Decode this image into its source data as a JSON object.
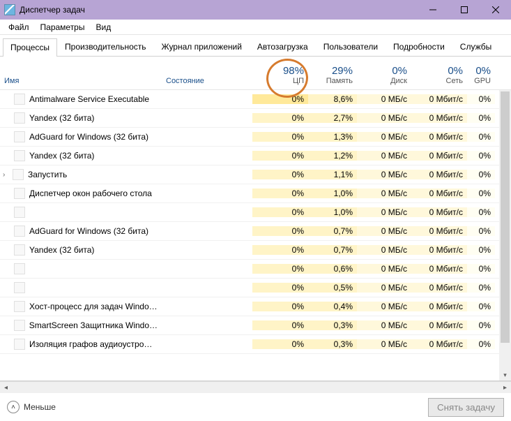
{
  "window": {
    "title": "Диспетчер задач"
  },
  "menu": {
    "file": "Файл",
    "options": "Параметры",
    "view": "Вид"
  },
  "tabs": {
    "processes": "Процессы",
    "performance": "Производительность",
    "app_history": "Журнал приложений",
    "startup": "Автозагрузка",
    "users": "Пользователи",
    "details": "Подробности",
    "services": "Службы"
  },
  "headers": {
    "name": "Имя",
    "state": "Состояние",
    "cpu_pct": "98%",
    "cpu": "ЦП",
    "mem_pct": "29%",
    "mem": "Память",
    "disk_pct": "0%",
    "disk": "Диск",
    "net_pct": "0%",
    "net": "Сеть",
    "gpu_pct": "0%",
    "gpu": "GPU"
  },
  "rows": [
    {
      "name": "Antimalware Service Executable",
      "expand": false,
      "cpu": "0%",
      "cpu_hot": true,
      "mem": "8,6%",
      "disk": "0 МБ/с",
      "net": "0 Мбит/с",
      "gpu": "0%"
    },
    {
      "name": "Yandex (32 бита)",
      "expand": false,
      "cpu": "0%",
      "cpu_hot": false,
      "mem": "2,7%",
      "disk": "0 МБ/с",
      "net": "0 Мбит/с",
      "gpu": "0%"
    },
    {
      "name": "AdGuard for Windows (32 бита)",
      "expand": false,
      "cpu": "0%",
      "cpu_hot": false,
      "mem": "1,3%",
      "disk": "0 МБ/с",
      "net": "0 Мбит/с",
      "gpu": "0%"
    },
    {
      "name": "Yandex (32 бита)",
      "expand": false,
      "cpu": "0%",
      "cpu_hot": false,
      "mem": "1,2%",
      "disk": "0 МБ/с",
      "net": "0 Мбит/с",
      "gpu": "0%"
    },
    {
      "name": "Запустить",
      "expand": true,
      "cpu": "0%",
      "cpu_hot": false,
      "mem": "1,1%",
      "disk": "0 МБ/с",
      "net": "0 Мбит/с",
      "gpu": "0%"
    },
    {
      "name": "Диспетчер окон рабочего стола",
      "expand": false,
      "cpu": "0%",
      "cpu_hot": false,
      "mem": "1,0%",
      "disk": "0 МБ/с",
      "net": "0 Мбит/с",
      "gpu": "0%"
    },
    {
      "name": "",
      "expand": false,
      "cpu": "0%",
      "cpu_hot": false,
      "mem": "1,0%",
      "disk": "0 МБ/с",
      "net": "0 Мбит/с",
      "gpu": "0%"
    },
    {
      "name": "AdGuard for Windows (32 бита)",
      "expand": false,
      "cpu": "0%",
      "cpu_hot": false,
      "mem": "0,7%",
      "disk": "0 МБ/с",
      "net": "0 Мбит/с",
      "gpu": "0%"
    },
    {
      "name": "Yandex (32 бита)",
      "expand": false,
      "cpu": "0%",
      "cpu_hot": false,
      "mem": "0,7%",
      "disk": "0 МБ/с",
      "net": "0 Мбит/с",
      "gpu": "0%"
    },
    {
      "name": "",
      "expand": false,
      "cpu": "0%",
      "cpu_hot": false,
      "mem": "0,6%",
      "disk": "0 МБ/с",
      "net": "0 Мбит/с",
      "gpu": "0%"
    },
    {
      "name": "",
      "expand": false,
      "cpu": "0%",
      "cpu_hot": false,
      "mem": "0,5%",
      "disk": "0 МБ/с",
      "net": "0 Мбит/с",
      "gpu": "0%"
    },
    {
      "name": "Хост-процесс для задач Windo…",
      "expand": false,
      "cpu": "0%",
      "cpu_hot": false,
      "mem": "0,4%",
      "disk": "0 МБ/с",
      "net": "0 Мбит/с",
      "gpu": "0%"
    },
    {
      "name": "SmartScreen Защитника Windo…",
      "expand": false,
      "cpu": "0%",
      "cpu_hot": false,
      "mem": "0,3%",
      "disk": "0 МБ/с",
      "net": "0 Мбит/с",
      "gpu": "0%"
    },
    {
      "name": "Изоляция графов аудиоустро…",
      "expand": false,
      "cpu": "0%",
      "cpu_hot": false,
      "mem": "0,3%",
      "disk": "0 МБ/с",
      "net": "0 Мбит/с",
      "gpu": "0%"
    }
  ],
  "footer": {
    "fewer": "Меньше",
    "end_task": "Снять задачу"
  }
}
